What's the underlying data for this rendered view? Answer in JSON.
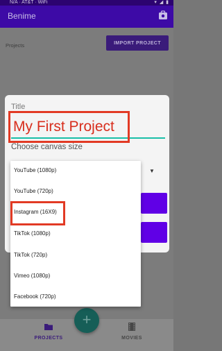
{
  "status_bar": {
    "text": "N/A  ·  AT&T  ·  WiFi",
    "icons": "▾ ◢ ▮"
  },
  "app_bar": {
    "title": "Benime",
    "icon": "camera-bag-icon"
  },
  "projects_label": "Projects",
  "import_button": "IMPORT PROJECT",
  "dialog": {
    "title_label": "Title",
    "title_value": "My First Project",
    "canvas_label": "Choose canvas size",
    "dropdown_arrow": "▼"
  },
  "canvas_options": [
    "YouTube (1080p)",
    "YouTube (720p)",
    "Instagram (16X9)",
    "TikTok (1080p)",
    "TikTok (720p)",
    "Vimeo (1080p)",
    "Facebook (720p)"
  ],
  "bottom_nav": {
    "projects": "PROJECTS",
    "movies": "MOVIES",
    "fab": "+"
  },
  "colors": {
    "primary": "#3d0aa6",
    "accent": "#6000e6",
    "teal": "#19bfa8",
    "highlight": "#e23a24"
  }
}
